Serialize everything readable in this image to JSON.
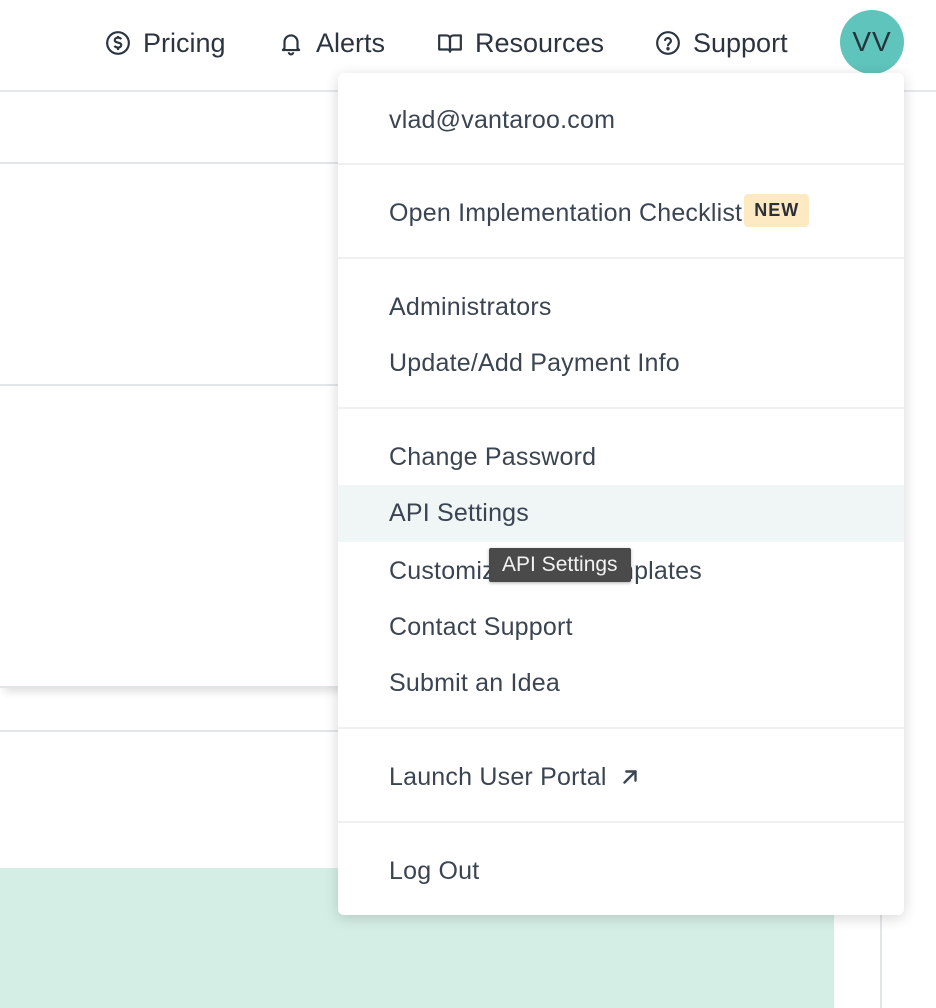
{
  "nav": {
    "pricing_label": "Pricing",
    "alerts_label": "Alerts",
    "resources_label": "Resources",
    "support_label": "Support",
    "avatar_initials": "VV"
  },
  "menu": {
    "email": "vlad@vantaroo.com",
    "checklist_label": "Open Implementation Checklist",
    "checklist_badge": "NEW",
    "administrators_label": "Administrators",
    "payment_label": "Update/Add Payment Info",
    "change_password_label": "Change Password",
    "api_settings_label": "API Settings",
    "custom_templates_label": "Customize Email Templates",
    "contact_support_label": "Contact Support",
    "submit_idea_label": "Submit an Idea",
    "launch_portal_label": "Launch User Portal",
    "logout_label": "Log Out"
  },
  "tooltip": {
    "text": "API Settings"
  },
  "colors": {
    "avatar_bg": "#5fc4bb",
    "badge_bg": "#fdeac3",
    "hover_bg": "#f0f6f6",
    "mint_panel": "#d4eee5",
    "tooltip_bg": "#4a4a4a"
  },
  "icons": {
    "pricing": "dollar-circle-icon",
    "alerts": "bell-icon",
    "resources": "open-book-icon",
    "support": "question-circle-icon",
    "launch_portal": "external-arrow-icon"
  }
}
